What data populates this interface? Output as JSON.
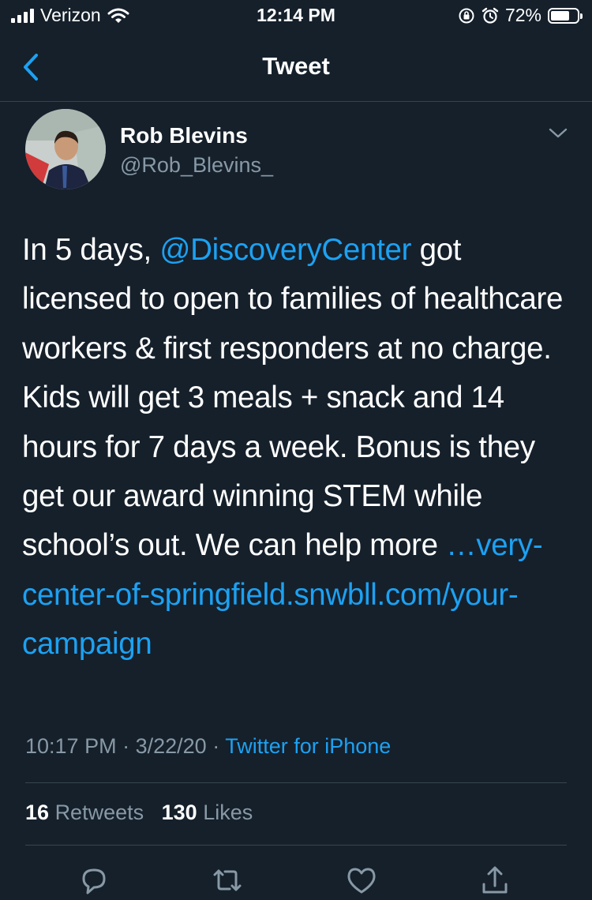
{
  "status_bar": {
    "carrier": "Verizon",
    "time": "12:14 PM",
    "battery": "72%",
    "battery_level": 0.72
  },
  "nav": {
    "title": "Tweet"
  },
  "tweet": {
    "author_name": "Rob Blevins",
    "author_handle": "@Rob_Blevins_",
    "text_1": "In 5 days, ",
    "mention": "@DiscoveryCenter",
    "text_2": " got licensed to open to families of healthcare workers & first responders at no charge. Kids will get 3 meals + snack and 14 hours for 7 days a week. Bonus is they get our award winning STEM while school’s out. We can help more ",
    "link": "…very-center-of-springfield.snwbll.com/your-campaign",
    "time": "10:17 PM",
    "date": "3/22/20",
    "separator": "·",
    "source": "Twitter for iPhone",
    "retweets_count": "16",
    "retweets_label": "Retweets",
    "likes_count": "130",
    "likes_label": "Likes"
  },
  "colors": {
    "background": "#15202b",
    "accent": "#1da1f2",
    "secondary_text": "#8899a6",
    "divider": "#38444d"
  },
  "icons": [
    "cellular-signal-icon",
    "wifi-icon",
    "orientation-lock-icon",
    "alarm-icon",
    "battery-icon",
    "back-chevron-icon",
    "chevron-down-icon",
    "reply-icon",
    "retweet-icon",
    "like-icon",
    "share-icon"
  ]
}
